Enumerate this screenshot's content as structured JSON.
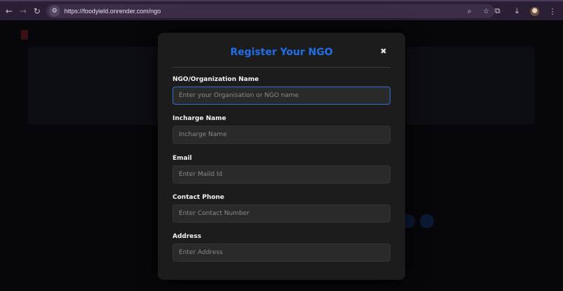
{
  "browser": {
    "url": "https://foodyield.onrender.com/ngo"
  },
  "modal": {
    "title": "Register Your NGO",
    "close_label": "✖",
    "fields": [
      {
        "label": "NGO/Organization Name",
        "placeholder": "Enter your Organisation or NGO name",
        "value": ""
      },
      {
        "label": "Incharge Name",
        "placeholder": "Incharge Name",
        "value": ""
      },
      {
        "label": "Email",
        "placeholder": "Enter Maild Id",
        "value": ""
      },
      {
        "label": "Contact Phone",
        "placeholder": "Enter Contact Number",
        "value": ""
      },
      {
        "label": "Address",
        "placeholder": "Enter Address",
        "value": ""
      }
    ]
  },
  "colors": {
    "accent": "#1f6fea",
    "modal_bg": "#1c1c1c",
    "input_bg": "#2a2a2a",
    "focus_border": "#2b6fd4"
  },
  "icons": {
    "back": "arrow-left-icon",
    "forward": "arrow-right-icon",
    "reload": "reload-icon",
    "site_settings": "tune-icon",
    "zoom": "zoom-icon",
    "bookmark": "star-icon",
    "extensions": "puzzle-icon",
    "download": "download-icon",
    "profile": "avatar",
    "menu": "kebab-menu-icon"
  }
}
